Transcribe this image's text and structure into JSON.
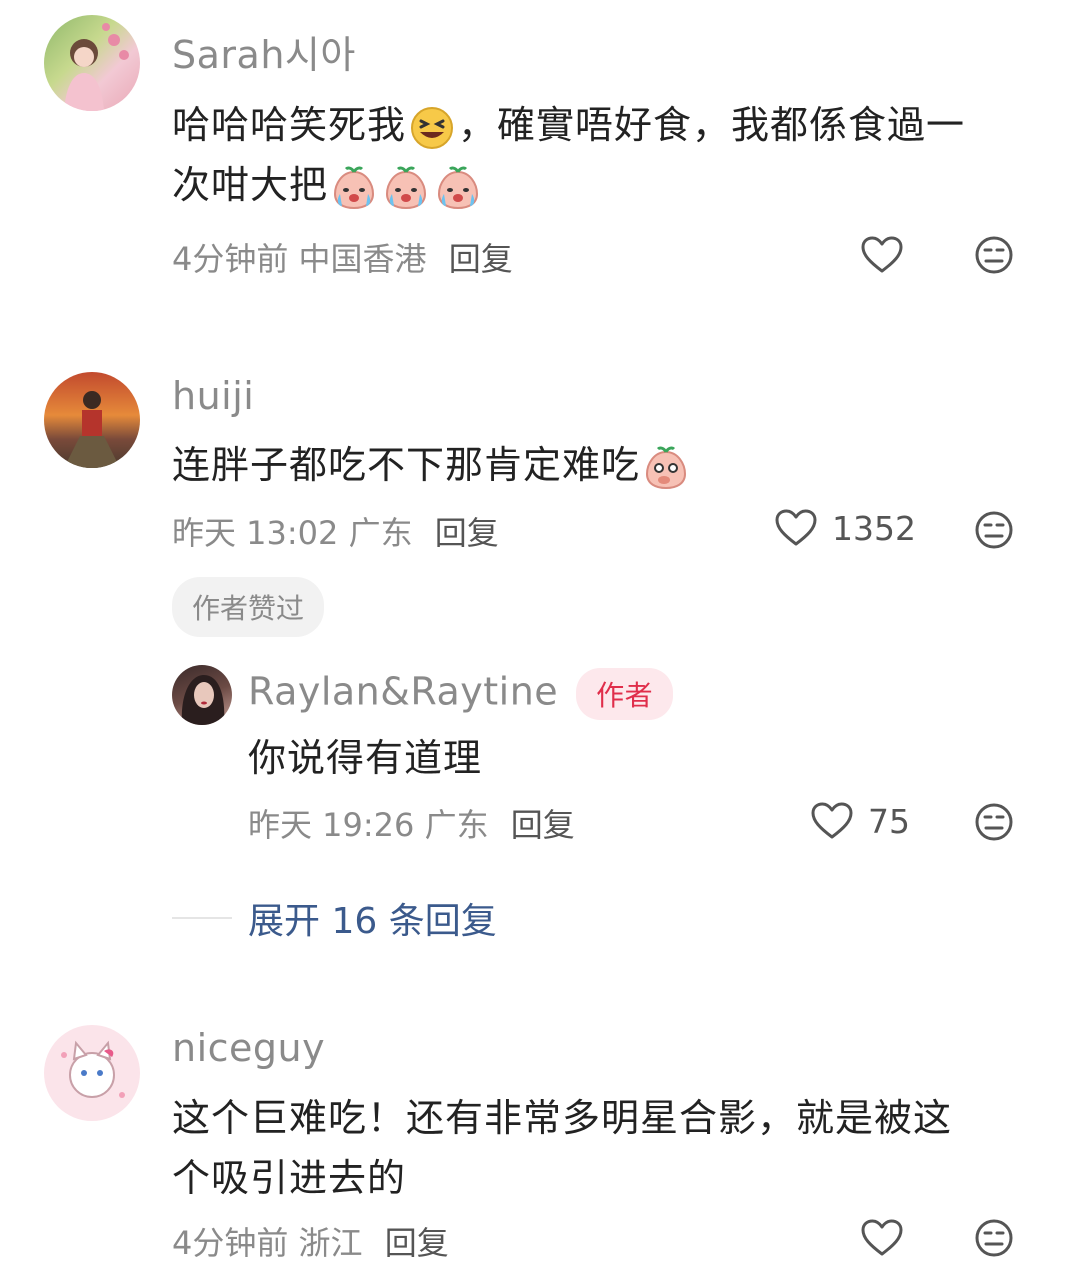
{
  "comments": [
    {
      "username": "Sarah시아",
      "text_line1": "哈哈哈笑死我",
      "text_line1b": "，確實唔好食，我都係食過一",
      "text_line2": "次咁大把",
      "time": "4分钟前",
      "location": "中国香港",
      "reply": "回复",
      "likes": "",
      "avatar_icon": "avatar-girl-photo"
    },
    {
      "username": "huiji",
      "text": "连胖子都吃不下那肯定难吃",
      "time": "昨天 13:02",
      "location": "广东",
      "reply": "回复",
      "likes": "1352",
      "author_liked": "作者赞过",
      "avatar_icon": "avatar-sunset-photo",
      "reply_item": {
        "username": "Raylan&Raytine",
        "author_badge": "作者",
        "text": "你说得有道理",
        "time": "昨天 19:26",
        "location": "广东",
        "reply": "回复",
        "likes": "75"
      },
      "expand_label": "展开 16 条回复"
    },
    {
      "username": "niceguy",
      "text_line1": "这个巨难吃！还有非常多明星合影，就是被这",
      "text_line2": "个吸引进去的",
      "time": "4分钟前",
      "location": "浙江",
      "reply": "回复",
      "likes": "",
      "avatar_icon": "avatar-cat-cartoon"
    }
  ],
  "colors": {
    "meta_gray": "#8a8a8a",
    "link_blue": "#3b5a8c",
    "author_red": "#e02e4b"
  }
}
